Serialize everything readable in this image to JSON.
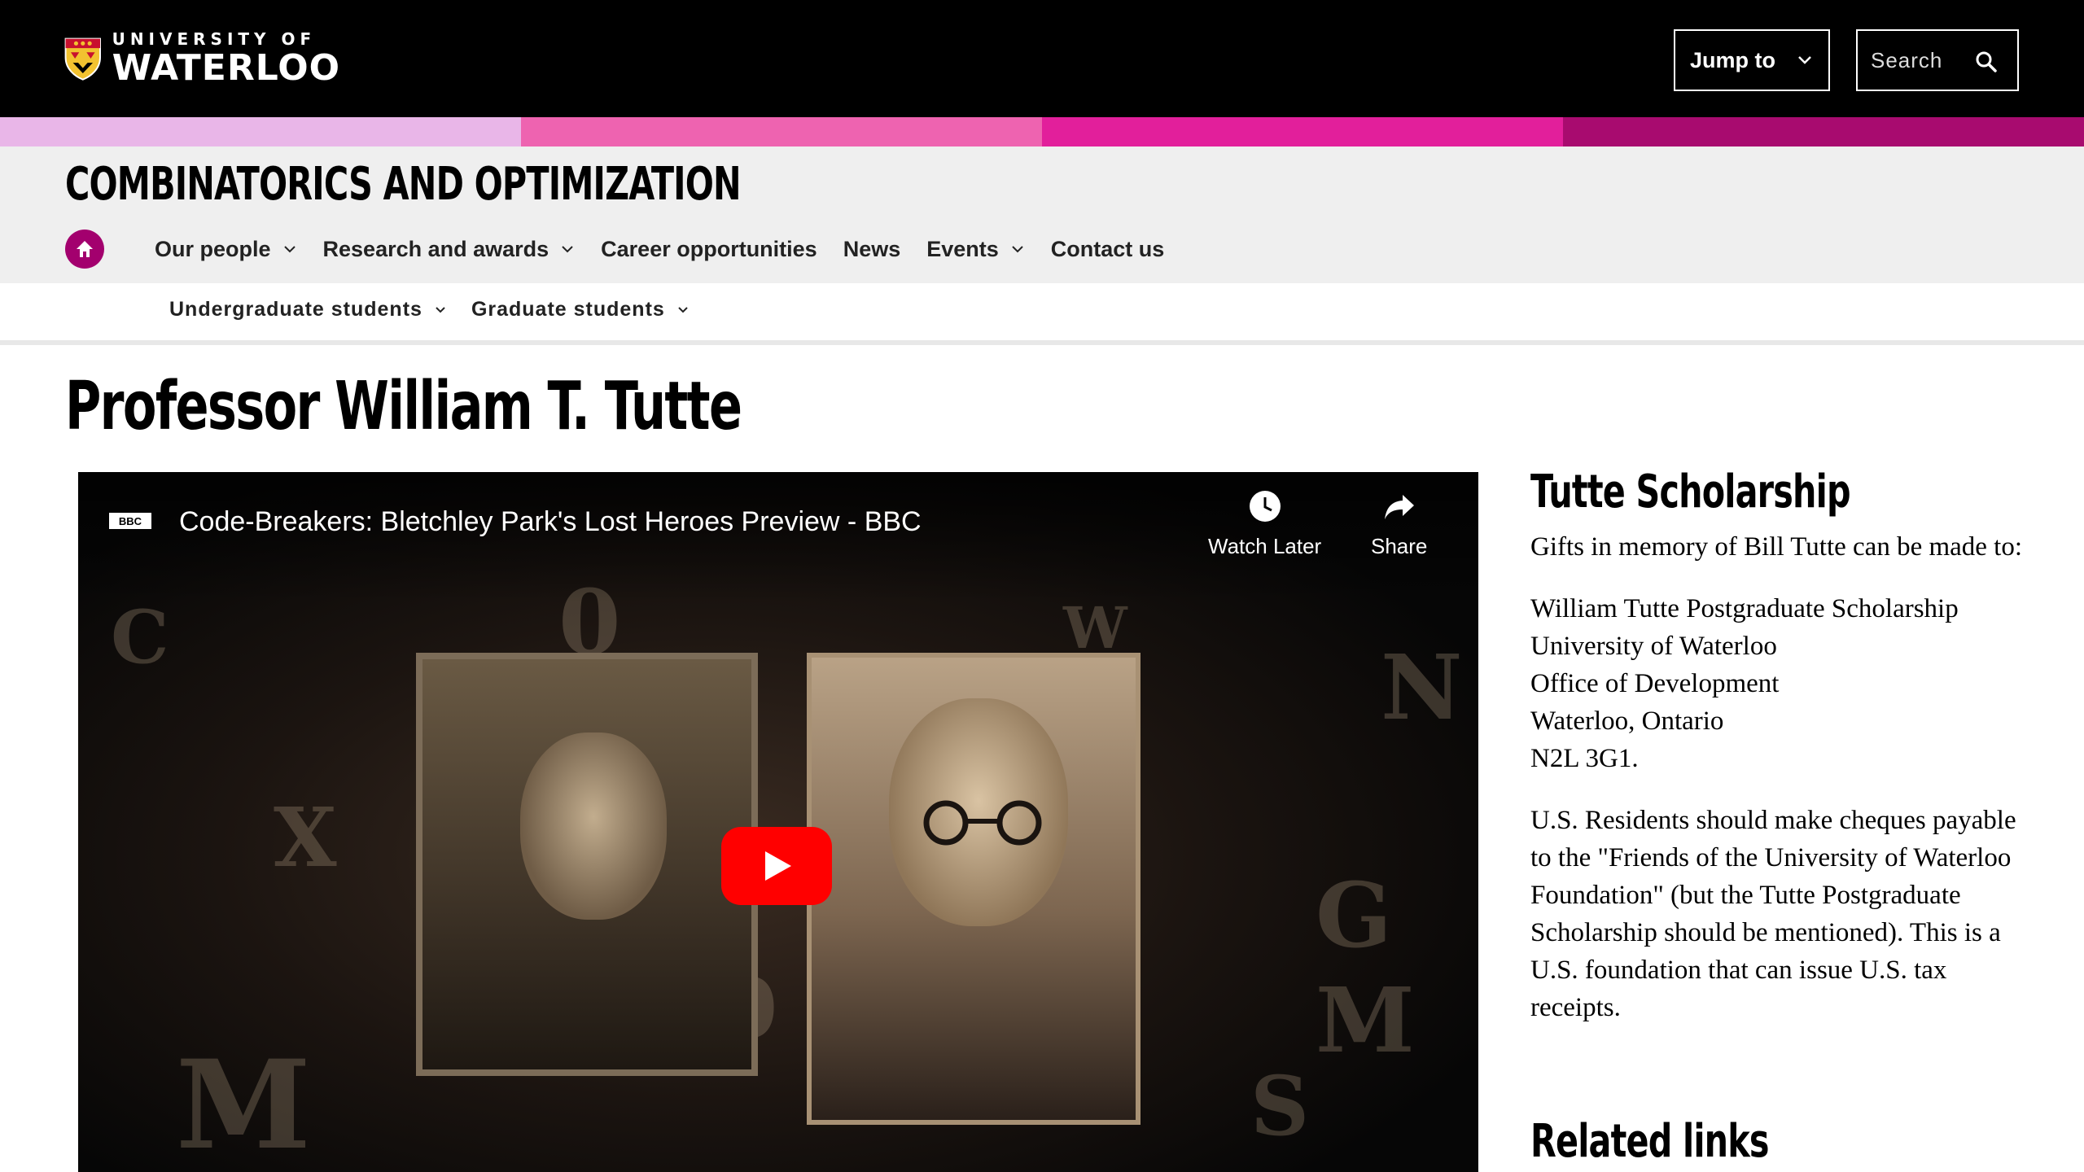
{
  "header": {
    "logo_small": "UNIVERSITY OF",
    "logo_big": "WATERLOO",
    "jump_to_label": "Jump to",
    "search_placeholder": "Search"
  },
  "colors": {
    "strip": [
      "#e9b6e8",
      "#ee63b0",
      "#e21f9b",
      "#a80b6f"
    ],
    "accent": "#a3006e"
  },
  "site": {
    "title": "COMBINATORICS AND OPTIMIZATION",
    "nav": [
      {
        "label": "Our people",
        "dropdown": true
      },
      {
        "label": "Research and awards",
        "dropdown": true
      },
      {
        "label": "Career opportunities",
        "dropdown": false
      },
      {
        "label": "News",
        "dropdown": false
      },
      {
        "label": "Events",
        "dropdown": true
      },
      {
        "label": "Contact us",
        "dropdown": false
      }
    ],
    "subnav": [
      {
        "label": "Undergraduate students"
      },
      {
        "label": "Graduate students"
      }
    ]
  },
  "page": {
    "title": "Professor William T. Tutte"
  },
  "video": {
    "channel_badge": "BBC",
    "title": "Code-Breakers: Bletchley Park's Lost Heroes Preview - BBC",
    "watch_later": "Watch Later",
    "share": "Share"
  },
  "sidebar": {
    "scholarship_heading": "Tutte Scholarship",
    "intro": "Gifts in memory of Bill Tutte can be made to:",
    "address": [
      "William Tutte Postgraduate Scholarship",
      "University of Waterloo",
      "Office of Development",
      "Waterloo, Ontario",
      "N2L 3G1."
    ],
    "us_note": "U.S. Residents should make cheques payable to the \"Friends of the University of Waterloo Foundation\" (but the Tutte Postgraduate Scholarship should be mentioned). This is a U.S. foundation that can issue U.S. tax receipts.",
    "related_heading": "Related links"
  }
}
